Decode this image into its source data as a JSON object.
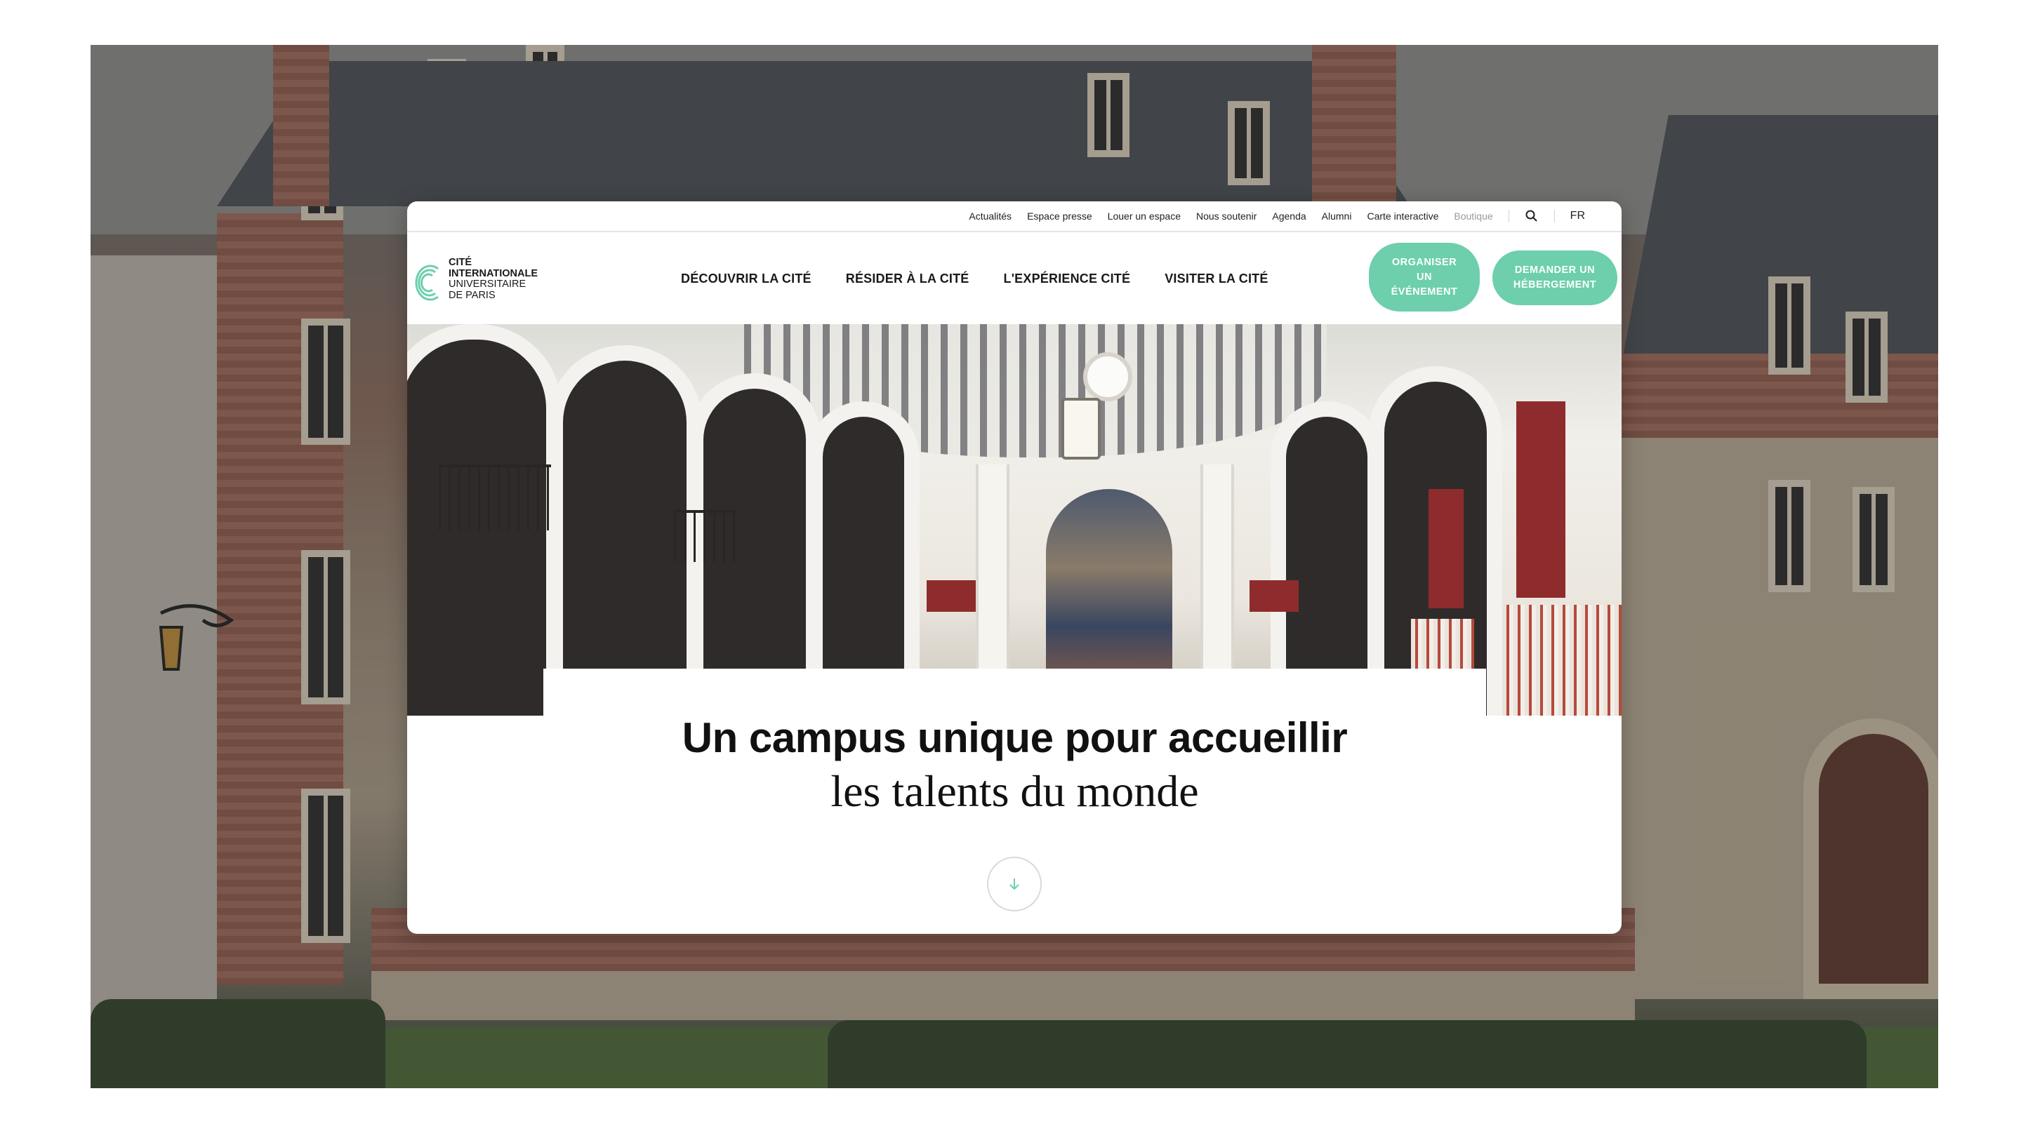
{
  "utility_nav": {
    "links": [
      "Actualités",
      "Espace presse",
      "Louer un espace",
      "Nous soutenir",
      "Agenda",
      "Alumni",
      "Carte interactive"
    ],
    "shop": "Boutique",
    "search_icon": "search-icon",
    "language": "FR"
  },
  "logo": {
    "line1": "Cité",
    "line2": "Internationale",
    "line3": "Universitaire",
    "line4": "de Paris"
  },
  "main_nav": {
    "items": [
      "Découvrir la Cité",
      "Résider à la Cité",
      "L'expérience Cité",
      "Visiter la Cité"
    ]
  },
  "cta": {
    "event": "Organiser un événement",
    "housing": "Demander un hébergement"
  },
  "hero": {
    "title": "Un campus unique pour accueillir",
    "subtitle": "les talents du monde",
    "scroll_icon": "arrow-down-icon"
  },
  "colors": {
    "accent": "#6dcfac",
    "text": "#111111",
    "muted": "#9a9a9a"
  }
}
